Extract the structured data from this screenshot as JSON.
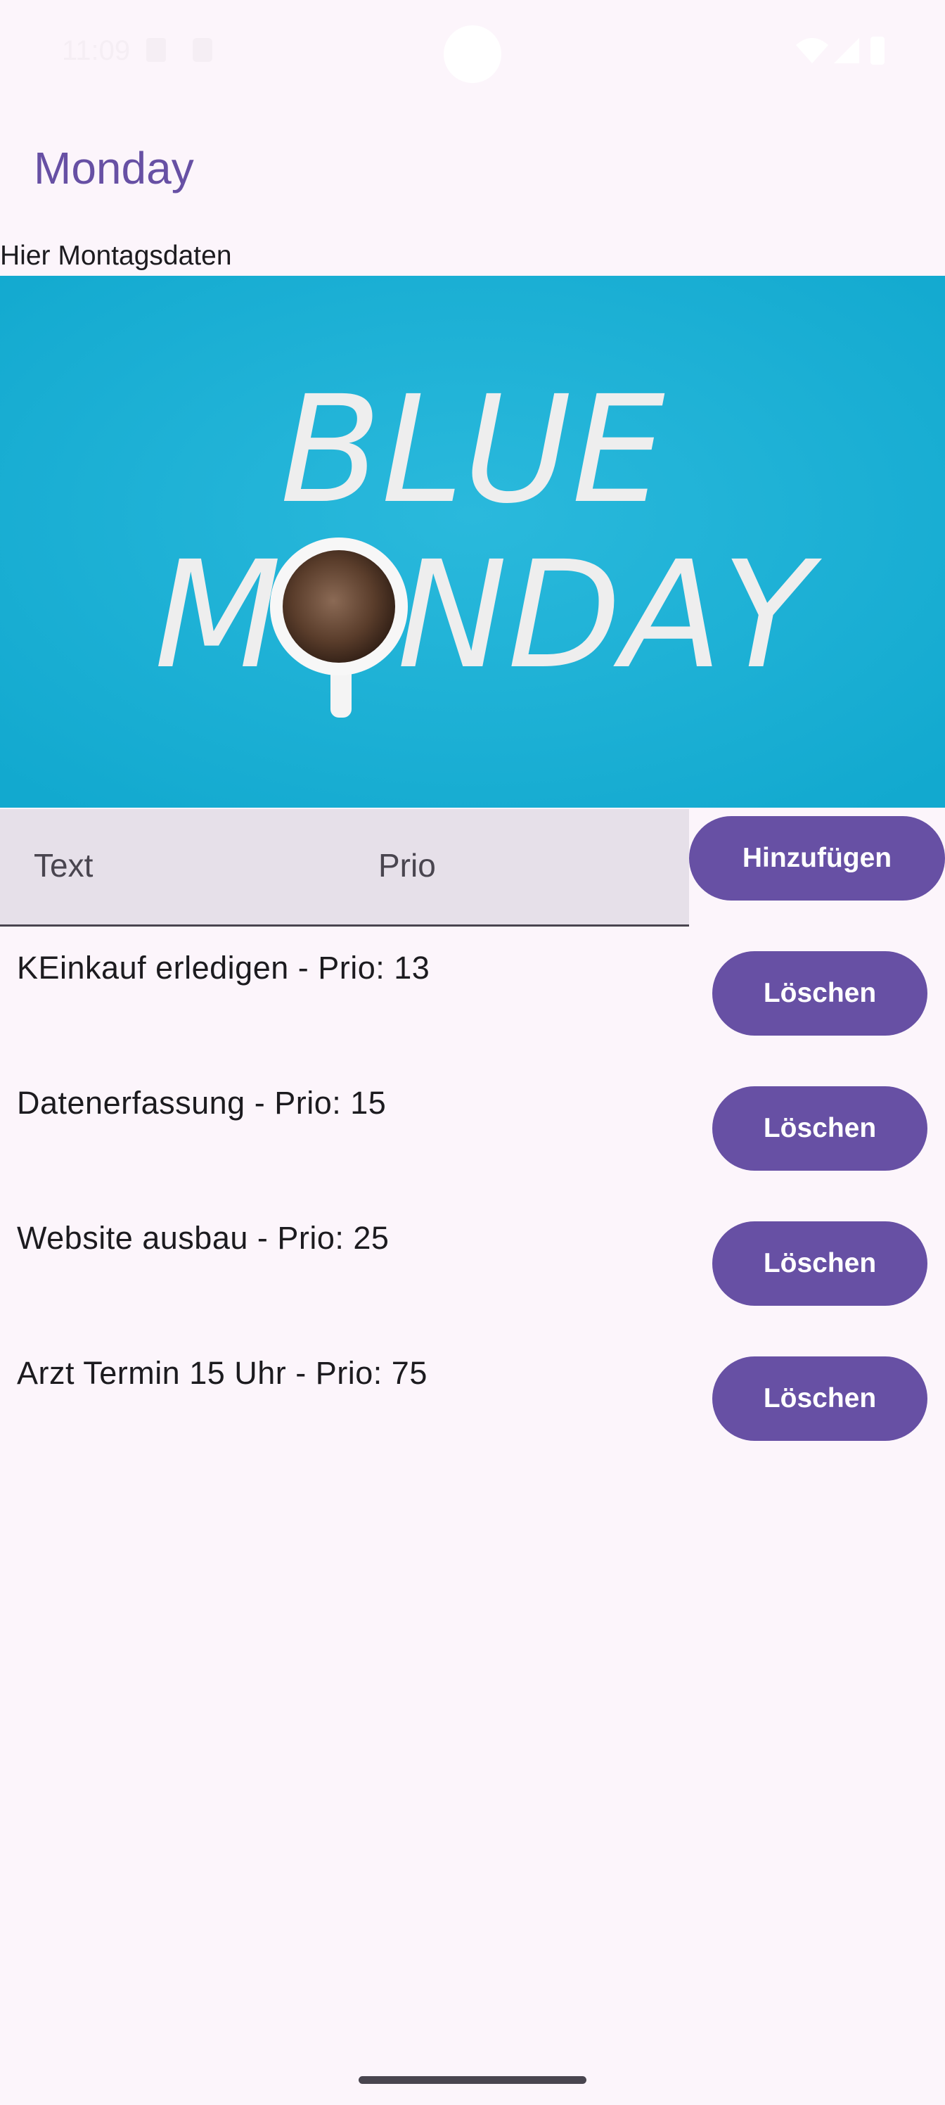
{
  "status_bar": {
    "time": "11:09"
  },
  "app_bar": {
    "title": "Monday"
  },
  "page": {
    "subtitle": "Hier Montagsdaten"
  },
  "banner": {
    "image_text_line1": "BLUE",
    "image_text_line2_left": "M",
    "image_text_line2_right": "NDAY"
  },
  "form": {
    "text_placeholder": "Text",
    "prio_placeholder": "Prio",
    "add_label": "Hinzufügen"
  },
  "tasks": [
    {
      "label": "KEinkauf erledigen - Prio: 13",
      "delete_label": "Löschen"
    },
    {
      "label": "Datenerfassung - Prio: 15",
      "delete_label": "Löschen"
    },
    {
      "label": "Website ausbau - Prio: 25",
      "delete_label": "Löschen"
    },
    {
      "label": "Arzt Termin 15 Uhr - Prio: 75",
      "delete_label": "Löschen"
    }
  ],
  "colors": {
    "primary": "#6750a4",
    "background": "#fcf5fb",
    "input_fill": "#e6e0e9",
    "banner_blue": "#22b2d6"
  }
}
